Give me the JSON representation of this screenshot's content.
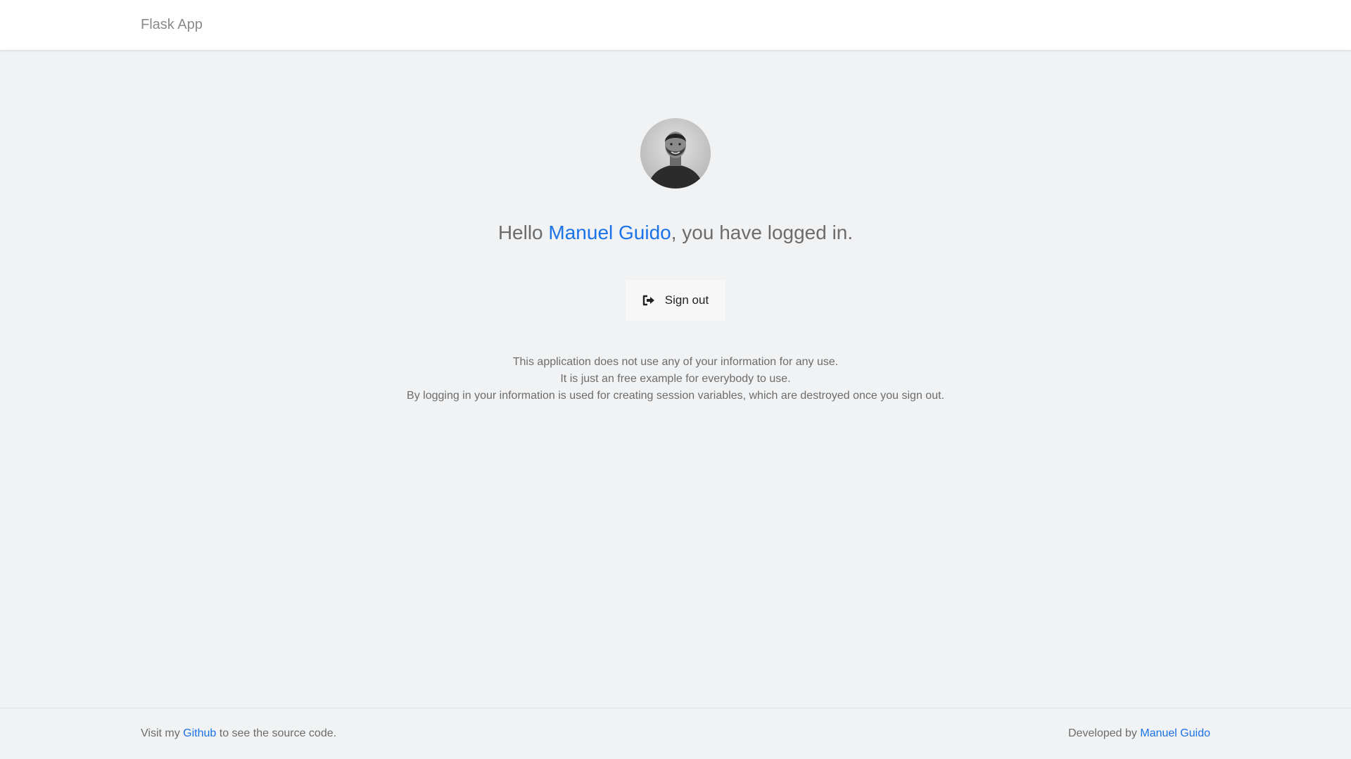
{
  "navbar": {
    "brand": "Flask App"
  },
  "main": {
    "greeting_prefix": "Hello ",
    "user_name": "Manuel Guido",
    "greeting_suffix": ", you have logged in.",
    "signout_label": "Sign out",
    "signout_icon": "sign-out-icon",
    "info_lines": [
      "This application does not use any of your information for any use.",
      "It is just an free example for everybody to use.",
      "By logging in your information is used for creating session variables, which are destroyed once you sign out."
    ]
  },
  "footer": {
    "left_prefix": "Visit my ",
    "left_link": "Github",
    "left_suffix": " to see the source code.",
    "right_prefix": "Developed by ",
    "right_link": "Manuel Guido"
  },
  "colors": {
    "background": "#f0f2f4",
    "link": "#1a73e8",
    "text": "#6c6c6c"
  }
}
